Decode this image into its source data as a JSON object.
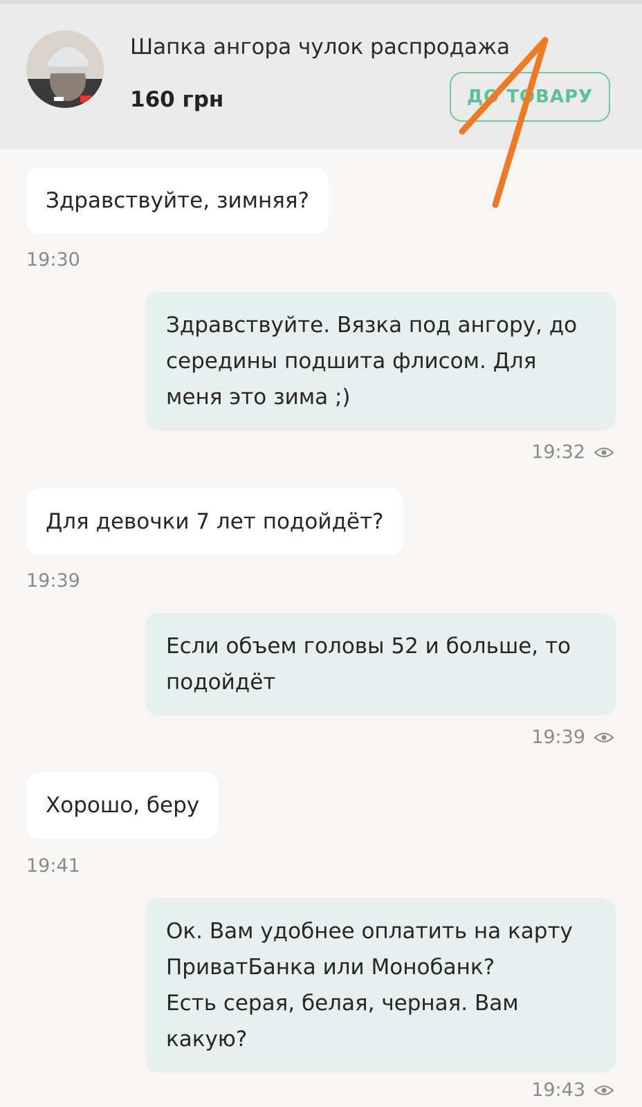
{
  "header": {
    "product_title": "Шапка ангора чулок распродажа",
    "price": "160 грн",
    "to_product_label": "ДО ТОВАРУ",
    "avatar_icon": "product-photo-hat"
  },
  "colors": {
    "accent": "#5cc296",
    "incoming_bubble": "#ffffff",
    "outgoing_bubble": "#e6f1ef",
    "annotation_arrow": "#f07a24"
  },
  "messages": [
    {
      "direction": "in",
      "lines": [
        "Здравствуйте, зимняя?"
      ],
      "time": "19:30"
    },
    {
      "direction": "out",
      "lines": [
        "Здравствуйте. Вязка под ангору, до",
        "середины подшита флисом. Для",
        "меня это зима ;)"
      ],
      "time": "19:32",
      "seen_icon": "eye-icon"
    },
    {
      "direction": "in",
      "lines": [
        "Для девочки 7 лет подойдёт?"
      ],
      "time": "19:39"
    },
    {
      "direction": "out",
      "lines": [
        "Если объем головы 52 и больше, то",
        "подойдёт"
      ],
      "time": "19:39",
      "seen_icon": "eye-icon"
    },
    {
      "direction": "in",
      "lines": [
        "Хорошо, беру"
      ],
      "time": "19:41"
    },
    {
      "direction": "out",
      "lines": [
        "Ок. Вам удобнее оплатить на карту",
        "ПриватБанка или Монобанк?",
        "Есть серая, белая, черная. Вам",
        "какую?"
      ],
      "time": "19:43",
      "seen_icon": "eye-icon"
    }
  ]
}
